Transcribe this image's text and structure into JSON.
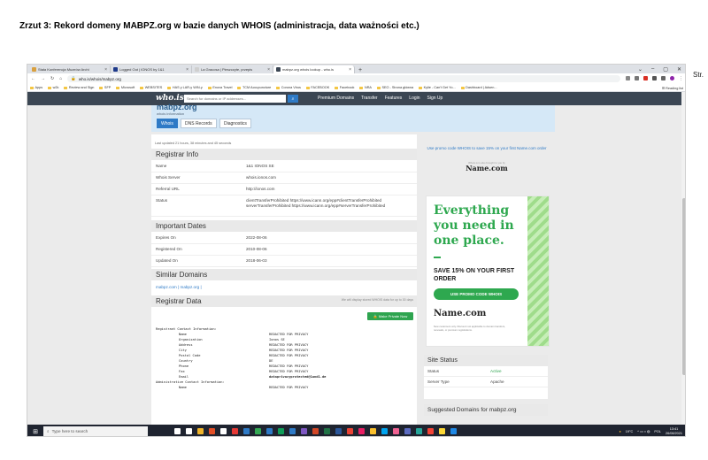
{
  "caption": "Zrzut 3: Rekord domeny MABPZ.org w bazie danych WHOIS (administracja, data ważności etc.)",
  "side_note": "Str.",
  "browser": {
    "tabs": [
      {
        "label": "Stała Konferencja Muzeów Archi",
        "color": "#d9a03f"
      },
      {
        "label": "Logged Out | IONOS by 1&1",
        "color": "#1e3a8a"
      },
      {
        "label": "La Gracosa | Pieszczyte, przepis",
        "color": "#cfcfcf"
      },
      {
        "label": "mabpz.org whois lookup - who.is",
        "color": "#3b4653"
      }
    ],
    "active_tab": 3,
    "url": "who.is/whois/mabpz.org",
    "bookmarks": [
      "Apps",
      "w2k",
      "Review and Sign",
      "SFP",
      "Microsoft",
      "WEBSITES",
      "HAS y LAR-y WIN-y",
      "Enova Travel",
      "TCM Accupuncture",
      "Corona Virus",
      "FACEBOOK",
      "Facebook",
      "NRA",
      "SEO - Strona główna",
      "Kylie - Can't Get Yo...",
      "Dashboard | Adsen..."
    ],
    "reading_list": "Reading list"
  },
  "site": {
    "logo": "who.is",
    "search_placeholder": "Search for domains or IP addresses...",
    "nav": [
      "Premium Domains",
      "Transfer",
      "Features",
      "Login",
      "Sign Up"
    ]
  },
  "domain": {
    "title": "mabpz.org",
    "subtitle": "whois information",
    "tabs": [
      "Whois",
      "DNS Records",
      "Diagnostics"
    ]
  },
  "updated": "Last updated 21 hours, 38 minutes and 45 seconds",
  "registrar_info": {
    "title": "Registrar Info",
    "rows": [
      {
        "k": "Name",
        "v": "1&1 IONOS SE"
      },
      {
        "k": "Whois Server",
        "v": "whois.ionos.com"
      },
      {
        "k": "Referral URL",
        "v": "http://ionos.com"
      },
      {
        "k": "Status",
        "v": "clientTransferProhibited https://www.icann.org/epp#clientTransferProhibited serverTransferProhibited https://www.icann.org/epp#serverTransferProhibited"
      }
    ]
  },
  "important_dates": {
    "title": "Important Dates",
    "rows": [
      {
        "k": "Expires On",
        "v": "2022-08-06"
      },
      {
        "k": "Registered On",
        "v": "2010-08-06"
      },
      {
        "k": "Updated On",
        "v": "2018-06-03"
      }
    ]
  },
  "similar_domains": {
    "title": "Similar Domains",
    "links": "mabpz.com | mabpz.org |"
  },
  "registrar_data": {
    "title": "Registrar Data",
    "note": "We will display stored WHOIS data for up to 30 days",
    "button": "Make Private Now",
    "raw": [
      {
        "k": "Registrant Contact Information:",
        "v": "",
        "ind": false,
        "bold": false
      },
      {
        "k": "Name",
        "v": "REDACTED FOR PRIVACY",
        "ind": true,
        "bold": false
      },
      {
        "k": "Organization",
        "v": "Ionos SE",
        "ind": true,
        "bold": false
      },
      {
        "k": "Address",
        "v": "REDACTED FOR PRIVACY",
        "ind": true,
        "bold": false
      },
      {
        "k": "City",
        "v": "REDACTED FOR PRIVACY",
        "ind": true,
        "bold": false
      },
      {
        "k": "Postal Code",
        "v": "REDACTED FOR PRIVACY",
        "ind": true,
        "bold": false
      },
      {
        "k": "Country",
        "v": "DE",
        "ind": true,
        "bold": false
      },
      {
        "k": "Phone",
        "v": "REDACTED FOR PRIVACY",
        "ind": true,
        "bold": false
      },
      {
        "k": "Fax",
        "v": "REDACTED FOR PRIVACY",
        "ind": true,
        "bold": false
      },
      {
        "k": "Email",
        "v": "dataprivacyprotected@1und1.de",
        "ind": true,
        "bold": true
      },
      {
        "k": "Administrative Contact Information:",
        "v": "",
        "ind": false,
        "bold": false
      },
      {
        "k": "Name",
        "v": "REDACTED FOR PRIVACY",
        "ind": true,
        "bold": false
      }
    ]
  },
  "sidebar": {
    "promo": "Use promo code WHOIS to save 15% on your first Name.com order",
    "small_by": "Whois.is is also brought to you by",
    "small_logo": "Name.com",
    "ad": {
      "headline": "Everything you need in one place.",
      "offer": "SAVE 15% ON YOUR FIRST ORDER",
      "button": "USE PROMO CODE WHOIS",
      "logo": "Name.com",
      "fine": "New customers only. Discount not applicable to domain transfers, renewals, or premium registrations."
    },
    "site_status": {
      "title": "Site Status",
      "rows": [
        {
          "k": "Status",
          "v": "Active"
        },
        {
          "k": "Server Type",
          "v": "Apache"
        }
      ]
    },
    "suggested": "Suggested Domains for mabpz.org"
  },
  "taskbar": {
    "search": "Type here to search",
    "weather": "19°C",
    "lang": "POL",
    "time": "13:41",
    "date": "26/08/2021",
    "icon_colors": [
      "#ffffff",
      "#ffffff",
      "#f0b429",
      "#e34f26",
      "#ffffff",
      "#e53935",
      "#2e7ac6",
      "#34a853",
      "#2e7ac6",
      "#0f9d58",
      "#2e7ac6",
      "#7e57c2",
      "#d24726",
      "#217346",
      "#2b579a",
      "#ea4335",
      "#e91e63",
      "#fbc02d",
      "#00a4ef",
      "#f06292",
      "#5c6bc0",
      "#26a69a",
      "#f44336",
      "#fdd835",
      "#1e88e5"
    ]
  }
}
